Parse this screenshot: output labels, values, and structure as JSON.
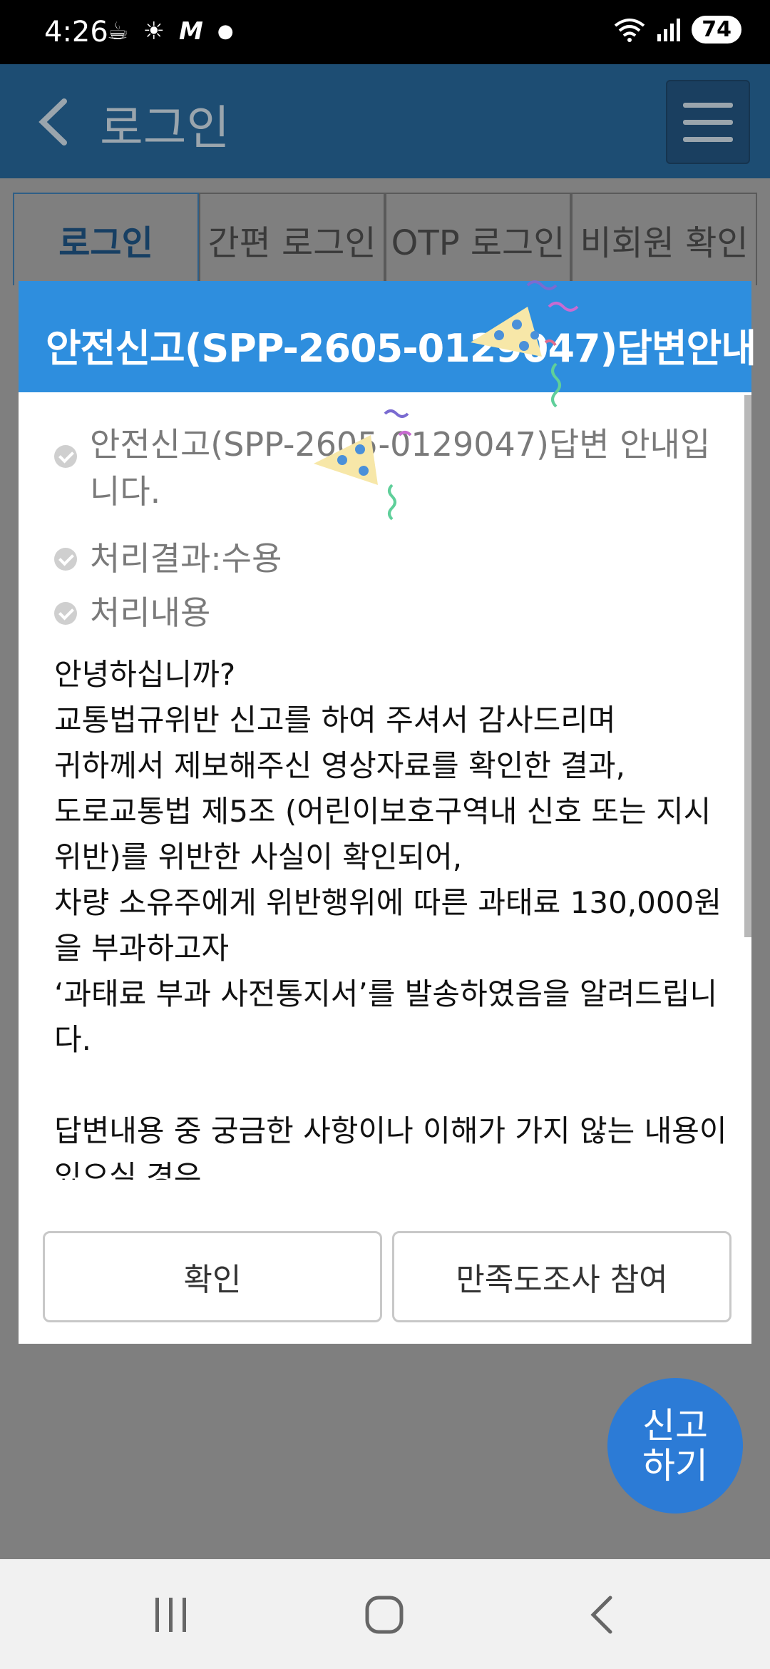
{
  "status_bar": {
    "time": "4:26",
    "battery": "74"
  },
  "app_bar": {
    "title": "로그인"
  },
  "tabs": [
    {
      "label": "로그인",
      "active": true
    },
    {
      "label": "간편 로그인"
    },
    {
      "label": "OTP 로그인"
    },
    {
      "label": "비회원 확인"
    }
  ],
  "modal": {
    "title": "안전신고(SPP-2605-0129047)답변안내",
    "items": [
      "안전신고(SPP-2605-0129047)답변 안내입니다.",
      "처리결과:수용",
      "처리내용"
    ],
    "body_lines": [
      "안녕하십니까?",
      "교통법규위반 신고를 하여 주셔서 감사드리며",
      "귀하께서 제보해주신 영상자료를 확인한 결과,",
      "도로교통법 제5조 (어린이보호구역내 신호 또는 지시 위반)를 위반한 사실이 확인되어,",
      "차량 소유주에게 위반행위에 따른 과태료 130,000원을 부과하고자",
      "‘과태료 부과 사전통지서’를 발송하였음을 알려드립니다.",
      "",
      "답변내용 중 궁금한 사항이나 이해가 가지 않는 내용이 있으실 경우"
    ],
    "confirm_label": "확인",
    "survey_label": "만족도조사 참여"
  },
  "fab": {
    "label": "신고\n하기"
  },
  "colors": {
    "header_blue": "#2e8ede",
    "fab_blue": "#2c7bd6"
  }
}
